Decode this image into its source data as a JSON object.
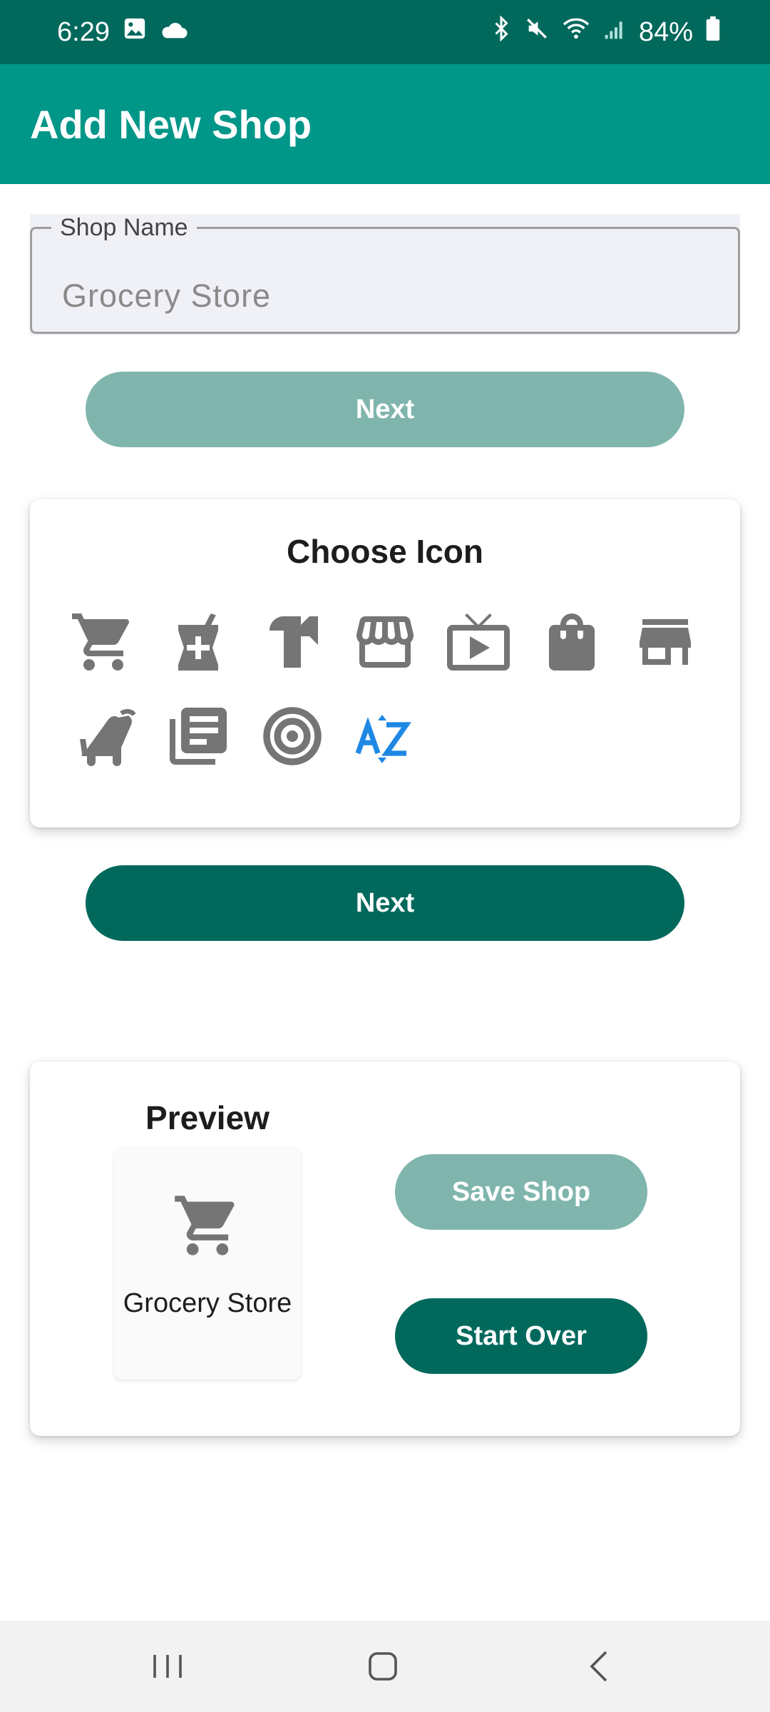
{
  "status_bar": {
    "time": "6:29",
    "battery": "84%",
    "icons": [
      "image-icon",
      "cloud-icon",
      "bluetooth-icon",
      "mute-icon",
      "wifi-icon",
      "signal-icon",
      "battery-icon"
    ]
  },
  "app_bar": {
    "title": "Add New Shop"
  },
  "shop_name_field": {
    "label": "Shop Name",
    "value": "Grocery Store"
  },
  "name_next_button": {
    "label": "Next",
    "state": "disabled"
  },
  "choose_icon_card": {
    "title": "Choose Icon",
    "icons": [
      "shopping-cart-icon",
      "pharmacy-icon",
      "hardware-icon",
      "storefront-icon",
      "tv-icon",
      "shopping-bag-icon",
      "store-icon",
      "stroller-icon",
      "newspaper-icon",
      "target-icon",
      "sort-az-icon"
    ],
    "selected_icon": "sort-az-icon"
  },
  "icon_next_button": {
    "label": "Next"
  },
  "preview_card": {
    "title": "Preview",
    "tile_icon": "shopping-cart-icon",
    "tile_label": "Grocery Store",
    "save_button": "Save Shop",
    "start_over_button": "Start Over"
  },
  "colors": {
    "status_bar": "#00695c",
    "app_bar": "#009688",
    "primary": "#00695c",
    "disabled": "#80b5ad",
    "icon_gray": "#757575",
    "selected_icon": "#1e88e5"
  },
  "nav_bar": {
    "buttons": [
      "recents-icon",
      "home-icon",
      "back-icon"
    ]
  }
}
